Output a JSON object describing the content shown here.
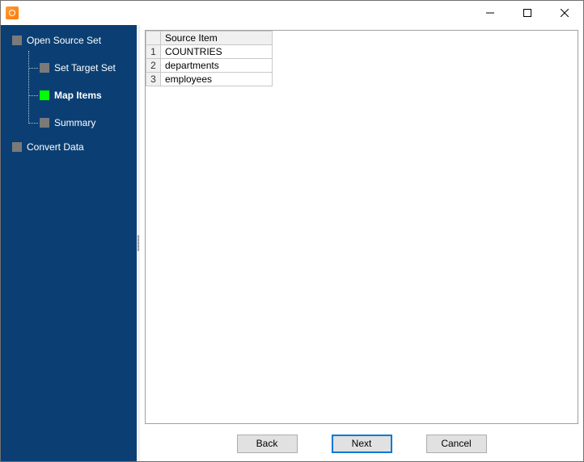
{
  "window": {
    "title": ""
  },
  "sidebar": {
    "items": [
      {
        "label": "Open Source Set",
        "active": false,
        "children": [
          {
            "label": "Set Target Set",
            "active": false
          },
          {
            "label": "Map Items",
            "active": true
          },
          {
            "label": "Summary",
            "active": false
          }
        ]
      },
      {
        "label": "Convert Data",
        "active": false,
        "children": []
      }
    ]
  },
  "grid": {
    "header": "Source Item",
    "rows": [
      {
        "n": "1",
        "item": "COUNTRIES"
      },
      {
        "n": "2",
        "item": "departments"
      },
      {
        "n": "3",
        "item": "employees"
      }
    ]
  },
  "buttons": {
    "back": "Back",
    "next": "Next",
    "cancel": "Cancel"
  }
}
